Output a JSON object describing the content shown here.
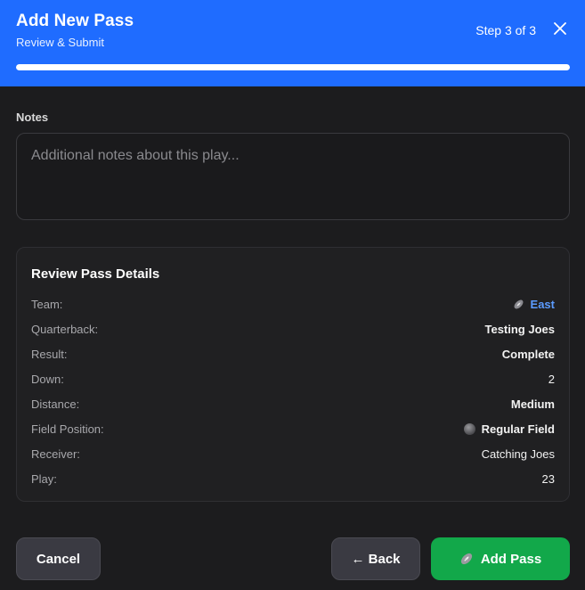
{
  "header": {
    "title": "Add New Pass",
    "subtitle": "Review & Submit",
    "step": "Step 3 of 3",
    "progress_fraction": 1.0,
    "accent_color": "#1f6cff"
  },
  "notes": {
    "label": "Notes",
    "placeholder": "Additional notes about this play...",
    "value": ""
  },
  "review": {
    "title": "Review Pass Details",
    "rows": [
      {
        "key": "Team:",
        "value": "East",
        "icon": "football-icon"
      },
      {
        "key": "Quarterback:",
        "value": "Testing Joes"
      },
      {
        "key": "Result:",
        "value": "Complete"
      },
      {
        "key": "Down:",
        "value": "2"
      },
      {
        "key": "Distance:",
        "value": "Medium"
      },
      {
        "key": "Field Position:",
        "value": "Regular Field",
        "icon": "ball-icon"
      },
      {
        "key": "Receiver:",
        "value": "Catching Joes"
      },
      {
        "key": "Play:",
        "value": "23"
      }
    ]
  },
  "actions": {
    "cancel_label": "Cancel",
    "back_label": "← Back",
    "add_label": "Add Pass",
    "add_icon": "football-icon",
    "add_color": "#12a84a"
  }
}
